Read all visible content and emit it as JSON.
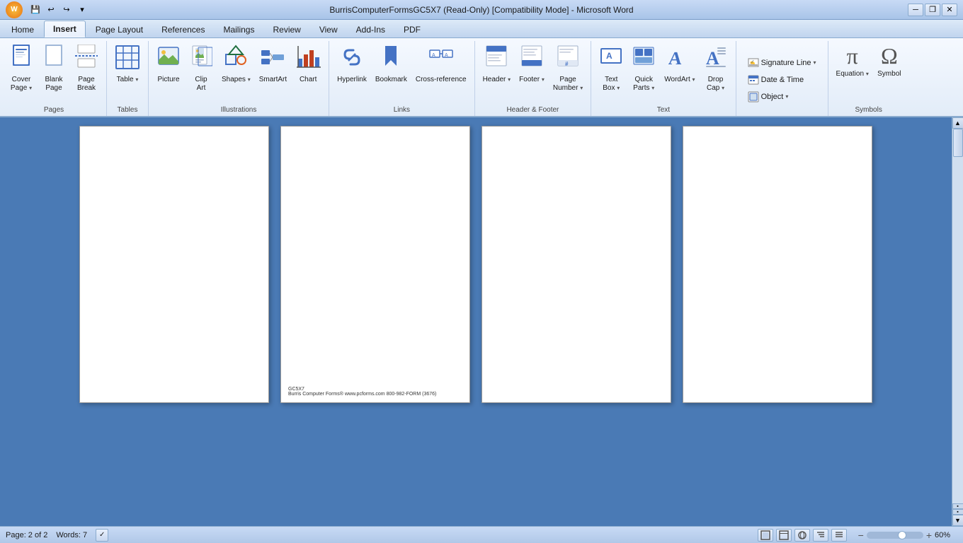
{
  "titlebar": {
    "title": "BurrisComputerFormsGC5X7 (Read-Only) [Compatibility Mode] - Microsoft Word",
    "min_label": "─",
    "restore_label": "❐",
    "close_label": "✕"
  },
  "quickaccess": {
    "save_label": "💾",
    "undo_label": "↩",
    "redo_label": "↪",
    "dropdown_label": "▾"
  },
  "tabs": [
    {
      "id": "home",
      "label": "Home"
    },
    {
      "id": "insert",
      "label": "Insert",
      "active": true
    },
    {
      "id": "pagelayout",
      "label": "Page Layout"
    },
    {
      "id": "references",
      "label": "References"
    },
    {
      "id": "mailings",
      "label": "Mailings"
    },
    {
      "id": "review",
      "label": "Review"
    },
    {
      "id": "view",
      "label": "View"
    },
    {
      "id": "addins",
      "label": "Add-Ins"
    },
    {
      "id": "pdf",
      "label": "PDF"
    }
  ],
  "ribbon": {
    "groups": [
      {
        "id": "pages",
        "label": "Pages",
        "items": [
          {
            "id": "cover-page",
            "label": "Cover\nPage",
            "icon": "📄",
            "dropdown": true
          },
          {
            "id": "blank-page",
            "label": "Blank\nPage",
            "icon": "📃"
          },
          {
            "id": "page-break",
            "label": "Page\nBreak",
            "icon": "⬜"
          }
        ]
      },
      {
        "id": "tables",
        "label": "Tables",
        "items": [
          {
            "id": "table",
            "label": "Table",
            "icon": "⊞",
            "dropdown": true
          }
        ]
      },
      {
        "id": "illustrations",
        "label": "Illustrations",
        "items": [
          {
            "id": "picture",
            "label": "Picture",
            "icon": "🖼"
          },
          {
            "id": "clip-art",
            "label": "Clip\nArt",
            "icon": "✂"
          },
          {
            "id": "shapes",
            "label": "Shapes",
            "icon": "△",
            "dropdown": true
          },
          {
            "id": "smartart",
            "label": "SmartArt",
            "icon": "🔷"
          },
          {
            "id": "chart",
            "label": "Chart",
            "icon": "📊"
          }
        ]
      },
      {
        "id": "links",
        "label": "Links",
        "items": [
          {
            "id": "hyperlink",
            "label": "Hyperlink",
            "icon": "🔗"
          },
          {
            "id": "bookmark",
            "label": "Bookmark",
            "icon": "🔖"
          },
          {
            "id": "cross-reference",
            "label": "Cross-reference",
            "icon": "↔"
          }
        ]
      },
      {
        "id": "header-footer",
        "label": "Header & Footer",
        "items": [
          {
            "id": "header",
            "label": "Header",
            "icon": "⬆",
            "dropdown": true
          },
          {
            "id": "footer",
            "label": "Footer",
            "icon": "⬇",
            "dropdown": true
          },
          {
            "id": "page-number",
            "label": "Page\nNumber",
            "icon": "#",
            "dropdown": true
          }
        ]
      },
      {
        "id": "text",
        "label": "Text",
        "items": [
          {
            "id": "text-box",
            "label": "Text\nBox",
            "icon": "🗐",
            "dropdown": true
          },
          {
            "id": "quick-parts",
            "label": "Quick\nParts",
            "icon": "⚡",
            "dropdown": true
          },
          {
            "id": "wordart",
            "label": "WordArt",
            "icon": "A",
            "dropdown": true
          },
          {
            "id": "drop-cap",
            "label": "Drop\nCap",
            "icon": "Ą",
            "dropdown": true
          }
        ]
      },
      {
        "id": "text2",
        "label": "",
        "items_small": [
          {
            "id": "signature-line",
            "label": "Signature Line",
            "icon": "✍",
            "dropdown": true
          },
          {
            "id": "date-time",
            "label": "Date & Time",
            "icon": "📅"
          },
          {
            "id": "object",
            "label": "Object",
            "icon": "⬜",
            "dropdown": true
          }
        ]
      },
      {
        "id": "symbols",
        "label": "Symbols",
        "items": [
          {
            "id": "equation",
            "label": "Equation",
            "icon": "π"
          },
          {
            "id": "symbol",
            "label": "Symbol",
            "icon": "Ω"
          }
        ]
      }
    ]
  },
  "document": {
    "page2_line1": "GC5X7",
    "page2_line2": "Burris Computer Forms® www.pcforms.com 800-982-FORM (3676)"
  },
  "statusbar": {
    "page_label": "Page: 2 of 2",
    "words_label": "Words: 7",
    "zoom_percent": "60%"
  }
}
